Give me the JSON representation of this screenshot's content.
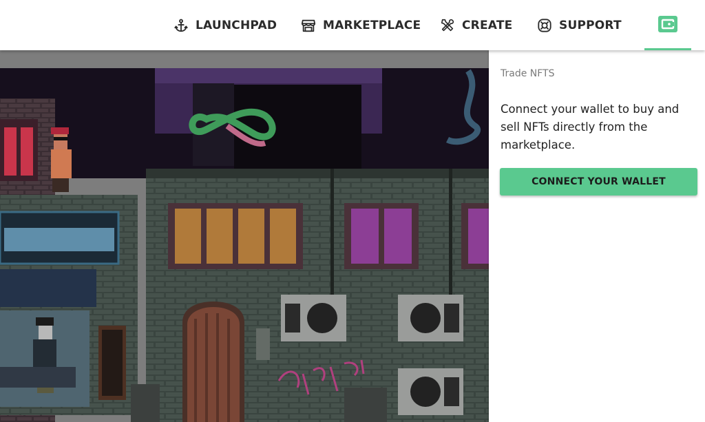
{
  "nav": {
    "items": [
      {
        "label": "LAUNCHPAD",
        "icon": "anchor-icon"
      },
      {
        "label": "MARKETPLACE",
        "icon": "store-icon"
      },
      {
        "label": "CREATE",
        "icon": "tools-icon"
      },
      {
        "label": "SUPPORT",
        "icon": "lifebuoy-icon"
      }
    ],
    "wallet_icon": "wallet-icon",
    "text_color": "#2b2b2b",
    "accent_color": "#5ac98f"
  },
  "panel": {
    "caption": "Trade NFTS",
    "description": "Connect your wallet to buy and sell NFTs directly from the marketplace.",
    "button_label": "CONNECT YOUR WALLET",
    "button_color": "#5ac98f"
  }
}
